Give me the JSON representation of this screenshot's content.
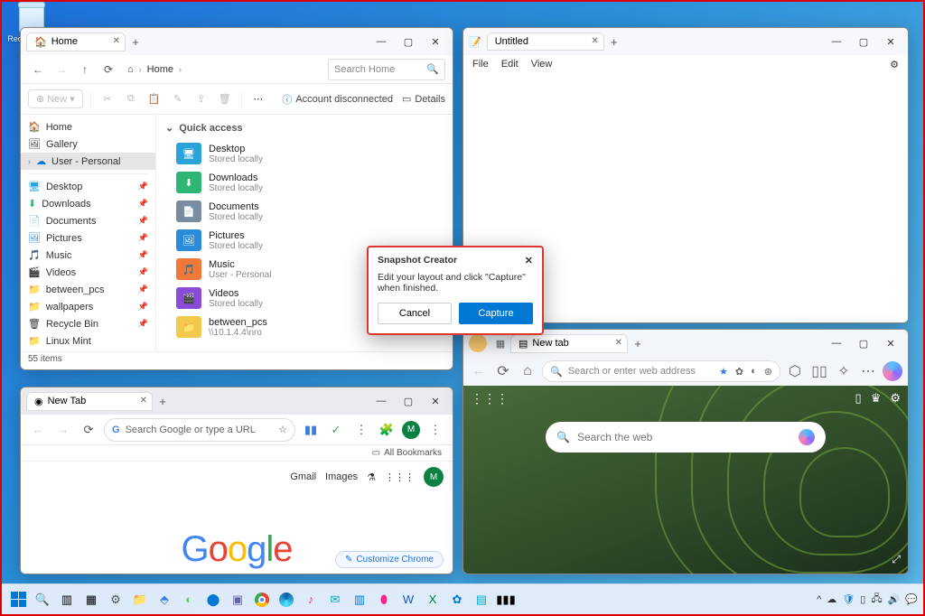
{
  "desktop": {
    "recycle_bin": "Recycle Bin"
  },
  "explorer": {
    "tab_title": "Home",
    "breadcrumb": "Home",
    "search_placeholder": "Search Home",
    "new_label": "New",
    "account_label": "Account disconnected",
    "details_label": "Details",
    "sidebar": {
      "home": "Home",
      "gallery": "Gallery",
      "user": "User - Personal",
      "desktop": "Desktop",
      "downloads": "Downloads",
      "documents": "Documents",
      "pictures": "Pictures",
      "music": "Music",
      "videos": "Videos",
      "between": "between_pcs",
      "wallpapers": "wallpapers",
      "recyclebin": "Recycle Bin",
      "linux": "Linux Mint"
    },
    "quick_access_header": "Quick access",
    "items": [
      {
        "name": "Desktop",
        "sub": "Stored locally",
        "color": "#29a3d8"
      },
      {
        "name": "Downloads",
        "sub": "Stored locally",
        "color": "#2fb574"
      },
      {
        "name": "Documents",
        "sub": "Stored locally",
        "color": "#7a8ca0"
      },
      {
        "name": "Pictures",
        "sub": "Stored locally",
        "color": "#2a8bd8"
      },
      {
        "name": "Music",
        "sub": "User - Personal",
        "color": "#f07838"
      },
      {
        "name": "Videos",
        "sub": "Stored locally",
        "color": "#8a4bd8"
      },
      {
        "name": "between_pcs",
        "sub": "\\\\10.1.4.4\\nro",
        "color": "#f2c94c"
      }
    ],
    "status": "55 items"
  },
  "notepad": {
    "tab_title": "Untitled",
    "menu": {
      "file": "File",
      "edit": "Edit",
      "view": "View"
    }
  },
  "chrome": {
    "tab_title": "New Tab",
    "omnibox_placeholder": "Search Google or type a URL",
    "bookmarks_label": "All Bookmarks",
    "links": {
      "gmail": "Gmail",
      "images": "Images"
    },
    "avatar_letter": "M",
    "customize": "Customize Chrome",
    "logo": "Google"
  },
  "edge": {
    "tab_title": "New tab",
    "omnibox_placeholder": "Search or enter web address",
    "search_placeholder": "Search the web"
  },
  "dialog": {
    "title": "Snapshot Creator",
    "message": "Edit your layout and click \"Capture\" when finished.",
    "cancel": "Cancel",
    "capture": "Capture"
  },
  "taskbar": {
    "time": ""
  }
}
